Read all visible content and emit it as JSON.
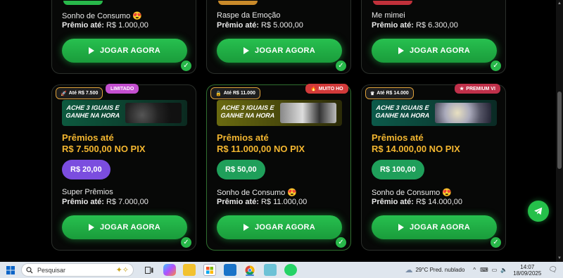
{
  "top_cards": [
    {
      "title": "Sonho de Consumo 😍",
      "prize_label": "Prêmio até:",
      "prize_value": "R$ 1.000,00",
      "button": "JOGAR AGORA",
      "stub_color": "#28b84a"
    },
    {
      "title": "Raspe da Emoção",
      "prize_label": "Prêmio até:",
      "prize_value": "R$ 5.000,00",
      "button": "JOGAR AGORA",
      "stub_color": "#c98a2a"
    },
    {
      "title": "Me mimei",
      "prize_label": "Prêmio até:",
      "prize_value": "R$ 6.300,00",
      "button": "JOGAR AGORA",
      "stub_color": "#c0303a"
    }
  ],
  "bottom_cards": [
    {
      "badge_left": "Até R$ 7.500",
      "badge_right": "LIMITADO",
      "badge_right_color": "#c44fd0",
      "banner_text_1": "ACHE 3 IGUAIS E",
      "banner_text_2": "GANHE NA HORA",
      "prizes_label": "Prêmios até",
      "prizes_value": "R$ 7.500,00 NO PIX",
      "price": "R$ 20,00",
      "price_color": "#7b4ddf",
      "title": "Super Prêmios",
      "prize_label": "Prêmio até:",
      "prize_value": "R$ 7.000,00",
      "button": "JOGAR AGORA"
    },
    {
      "badge_left": "Até R$ 11.000",
      "badge_right": "MUITO HO",
      "badge_right_color": "#d23a3a",
      "banner_text_1": "ACHE 3 IGUAIS E",
      "banner_text_2": "GANHE NA HORA",
      "prizes_label": "Prêmios até",
      "prizes_value": "R$ 11.000,00 NO PIX",
      "price": "R$ 50,00",
      "price_color": "#1f9f5a",
      "title": "Sonho de Consumo 😍",
      "prize_label": "Prêmio até:",
      "prize_value": "R$ 11.000,00",
      "button": "JOGAR AGORA"
    },
    {
      "badge_left": "Até R$ 14.000",
      "badge_right": "PREMIUM VI",
      "badge_right_color": "#c0304a",
      "banner_text_1": "ACHE 3 IGUAIS E",
      "banner_text_2": "GANHE NA HORA",
      "prizes_label": "Prêmios até",
      "prizes_value": "R$ 14.000,00 NO PIX",
      "price": "R$ 100,00",
      "price_color": "#1f9f5a",
      "title": "Sonho de Consumo 😍",
      "prize_label": "Prêmio até:",
      "prize_value": "R$ 14.000,00",
      "button": "JOGAR AGORA"
    }
  ],
  "taskbar": {
    "search_placeholder": "Pesquisar",
    "weather": "29°C  Pred. nublado",
    "time": "14:07",
    "date": "18/09/2025"
  },
  "icons": {
    "play": "play-icon",
    "check": "check-icon",
    "telegram": "telegram-icon"
  }
}
